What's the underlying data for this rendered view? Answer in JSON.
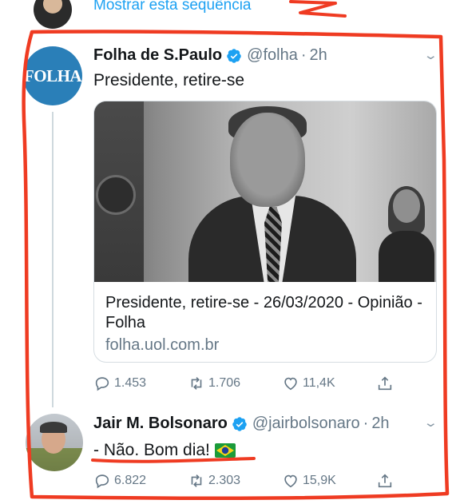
{
  "thread": {
    "show_thread_label": "Mostrar esta sequência"
  },
  "tweet_folha": {
    "avatar_text": "FOLHA",
    "name": "Folha de S.Paulo",
    "handle": "@folha",
    "separator": "·",
    "time": "2h",
    "text": "Presidente, retire-se",
    "card": {
      "title": "Presidente, retire-se - 26/03/2020 - Opinião - Folha",
      "domain": "folha.uol.com.br"
    },
    "actions": {
      "replies": "1.453",
      "retweets": "1.706",
      "likes": "11,4K"
    }
  },
  "tweet_jair": {
    "name": "Jair M. Bolsonaro",
    "handle": "@jairbolsonaro",
    "separator": "·",
    "time": "2h",
    "text": "- Não. Bom dia!",
    "flag_icon": "brazil-flag-emoji",
    "actions": {
      "replies": "6.822",
      "retweets": "2.303",
      "likes": "15,9K"
    }
  },
  "colors": {
    "link": "#1da1f2",
    "secondary_text": "#657786",
    "annotation": "#ef3b22",
    "folha_avatar": "#2a7fb8"
  }
}
